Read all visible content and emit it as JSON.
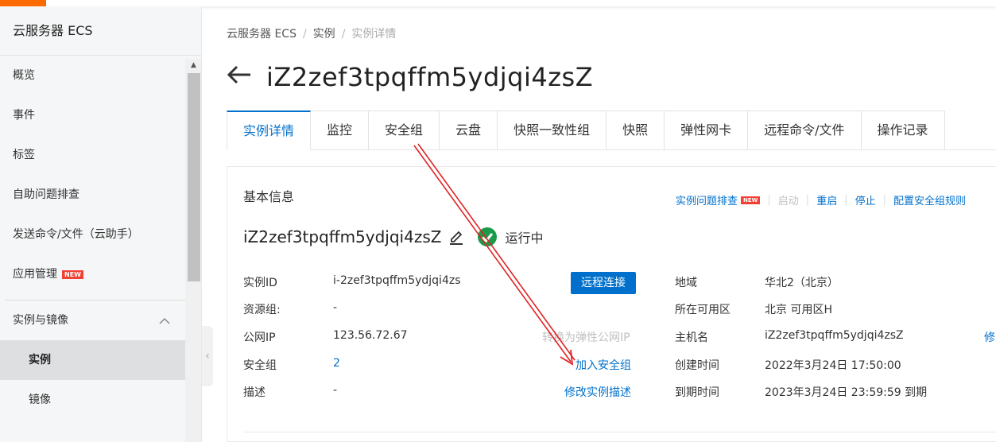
{
  "sidebar": {
    "title": "云服务器 ECS",
    "items": [
      {
        "label": "概览"
      },
      {
        "label": "事件"
      },
      {
        "label": "标签"
      },
      {
        "label": "自助问题排查"
      },
      {
        "label": "发送命令/文件（云助手）"
      },
      {
        "label": "应用管理",
        "badge": "NEW"
      }
    ],
    "group": {
      "label": "实例与镜像",
      "expanded": true,
      "children": [
        {
          "label": "实例",
          "active": true
        },
        {
          "label": "镜像"
        }
      ]
    }
  },
  "breadcrumb": {
    "items": [
      "云服务器 ECS",
      "实例",
      "实例详情"
    ],
    "separator": "/"
  },
  "header": {
    "title": "iZ2zef3tpqffm5ydjqi4zsZ"
  },
  "tabs": [
    {
      "label": "实例详情",
      "active": true
    },
    {
      "label": "监控"
    },
    {
      "label": "安全组"
    },
    {
      "label": "云盘"
    },
    {
      "label": "快照一致性组"
    },
    {
      "label": "快照"
    },
    {
      "label": "弹性网卡"
    },
    {
      "label": "远程命令/文件"
    },
    {
      "label": "操作记录"
    }
  ],
  "basic_info": {
    "title": "基本信息",
    "actions": {
      "troubleshoot": "实例问题排查",
      "troubleshoot_badge": "NEW",
      "start": "启动",
      "restart": "重启",
      "stop": "停止",
      "configure_sg_rules": "配置安全组规则"
    },
    "instance_name": "iZ2zef3tpqffm5ydjqi4zsZ",
    "status": "运行中",
    "left_fields": {
      "instance_id_label": "实例ID",
      "instance_id_value": "i-2zef3tpqffm5ydjqi4zs",
      "resource_group_label": "资源组:",
      "resource_group_value": "-",
      "public_ip_label": "公网IP",
      "public_ip_value": "123.56.72.67",
      "security_group_label": "安全组",
      "security_group_value": "2",
      "description_label": "描述",
      "description_value": "-"
    },
    "mid_actions": {
      "remote_connect": "远程连接",
      "convert_eip": "转换为弹性公网IP",
      "join_sg": "加入安全组",
      "edit_description": "修改实例描述"
    },
    "right_fields": {
      "region_label": "地域",
      "region_value": "华北2（北京）",
      "zone_label": "所在可用区",
      "zone_value": "北京 可用区H",
      "hostname_label": "主机名",
      "hostname_value": "iZ2zef3tpqffm5ydjqi4zsZ",
      "hostname_edit": "修",
      "created_label": "创建时间",
      "created_value": "2022年3月24日 17:50:00",
      "expire_label": "到期时间",
      "expire_value": "2023年3月24日 23:59:59 到期"
    }
  },
  "colors": {
    "accent": "#ff6a00",
    "primary": "#0070cc",
    "success": "#1a9a4a",
    "annotation": "#e02424"
  }
}
